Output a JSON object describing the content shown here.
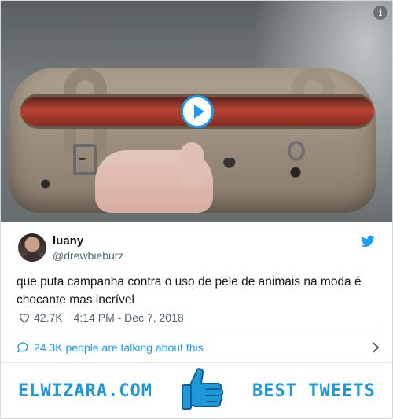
{
  "media": {
    "play_icon": "play-icon",
    "info_label": "i"
  },
  "author": {
    "name": "luany",
    "handle": "@drewbieburz",
    "logo_icon": "twitter-bird-icon"
  },
  "tweet": {
    "text": "que puta campanha contra o uso de pele de animais na moda é chocante mas incrível",
    "likes": "42.7K",
    "timestamp": "4:14 PM - Dec 7, 2018"
  },
  "conversation": {
    "label": "24.3K people are talking about this"
  },
  "banner": {
    "left_text": "ELWIZARA.COM",
    "right_text": "BEST TWEETS",
    "icon": "thumbs-up-icon"
  },
  "colors": {
    "accent": "#1d9bf0",
    "banner_blue": "#1e98d9",
    "text": "#14171a",
    "muted": "#536471"
  }
}
